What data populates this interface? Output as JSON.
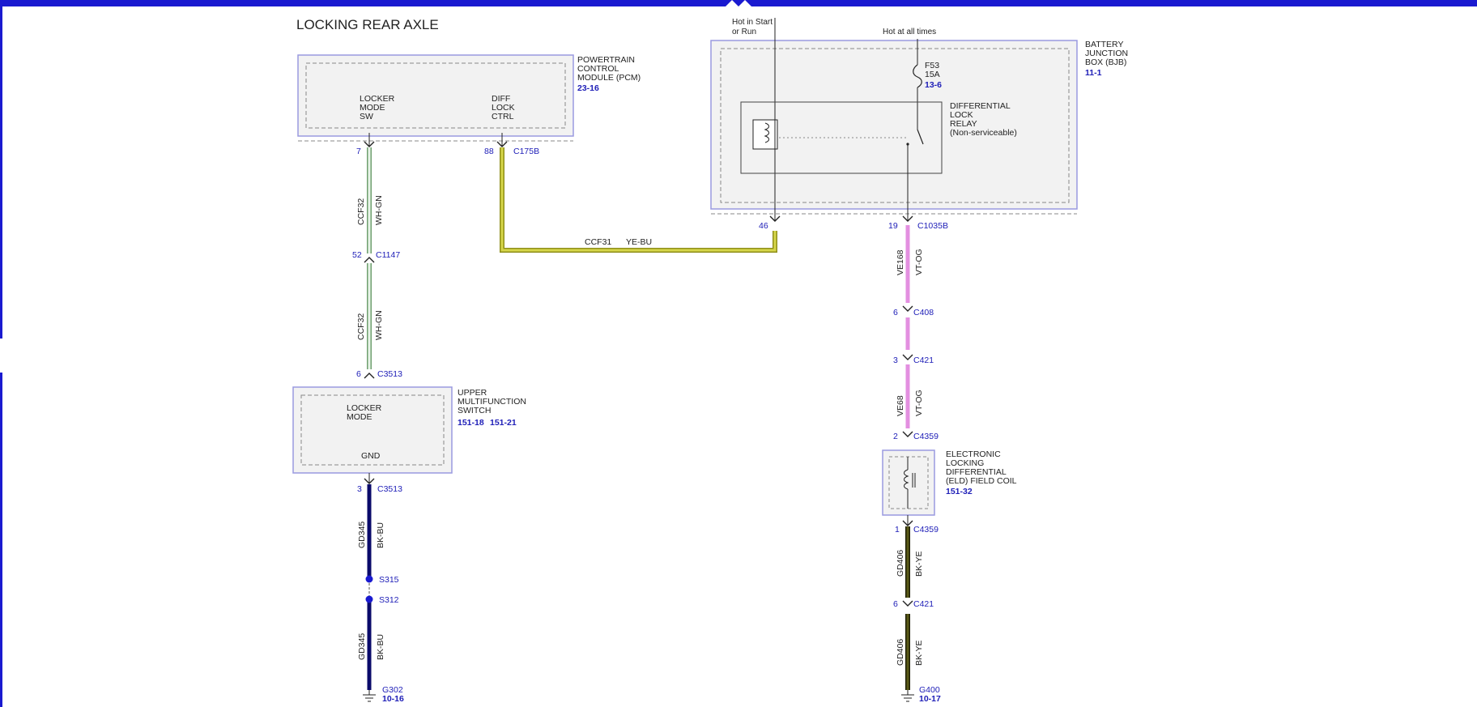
{
  "title": "LOCKING REAR AXLE",
  "colors": {
    "frame": "#1a1ad0",
    "module_border": "#9a9ae0",
    "module_fill": "#f2f2f2",
    "dashed": "#888888",
    "label": "#222222",
    "link": "#2020b8",
    "wire_wh_gn": "#9ec79e",
    "wire_ye_bu": "#c9c93a",
    "wire_bk_bu": "#0a0a6a",
    "wire_vt_og": "#e58ee0",
    "wire_bk_ye": "#4a4a14"
  },
  "power": {
    "hot_start_run": [
      "Hot in Start",
      "or Run"
    ],
    "hot_all_times": "Hot at all times"
  },
  "pcm": {
    "name": [
      "POWERTRAIN",
      "CONTROL",
      "MODULE (PCM)"
    ],
    "ref": "23-16",
    "pin_locker": [
      "LOCKER",
      "MODE",
      "SW"
    ],
    "pin_diff": [
      "DIFF",
      "LOCK",
      "CTRL"
    ],
    "pin_left_no": "7",
    "pin_right_no": "88",
    "connector": "C175B"
  },
  "bjb": {
    "name": [
      "BATTERY",
      "JUNCTION",
      "BOX (BJB)"
    ],
    "ref": "11-1",
    "fuse": [
      "F53",
      "15A"
    ],
    "fuse_ref": "13-6",
    "relay": [
      "DIFFERENTIAL",
      "LOCK",
      "RELAY",
      "(Non-serviceable)"
    ],
    "pin_left_no": "46",
    "pin_right_no": "19",
    "connector": "C1035B"
  },
  "wire_left": {
    "circuit": "CCF32",
    "color": "WH-GN",
    "conn_mid_pin": "52",
    "conn_mid": "C1147",
    "conn_bottom_pin": "6",
    "conn_bottom": "C3513"
  },
  "wire_mid": {
    "circuit": "CCF31",
    "color": "YE-BU"
  },
  "switch": {
    "name": [
      "UPPER",
      "MULTIFUNCTION",
      "SWITCH"
    ],
    "refs": [
      "151-18",
      "151-21"
    ],
    "pin_top": [
      "LOCKER",
      "MODE"
    ],
    "pin_bottom": "GND"
  },
  "ground_left": {
    "pin": "3",
    "conn": "C3513",
    "circuit": "GD345",
    "color": "BK-BU",
    "splice1": "S315",
    "splice2": "S312",
    "ground": "G302",
    "ground_ref": "10-16"
  },
  "wire_right": {
    "circuit": "VE168",
    "color": "VT-OG",
    "circuit2": "VE68",
    "c408_pin": "6",
    "c408": "C408",
    "c421_pin": "3",
    "c421": "C421",
    "c4359_pin": "2",
    "c4359": "C4359"
  },
  "eld": {
    "name": [
      "ELECTRONIC",
      "LOCKING",
      "DIFFERENTIAL",
      "(ELD) FIELD COIL"
    ],
    "ref": "151-32"
  },
  "ground_right": {
    "c4359_pin": "1",
    "c4359": "C4359",
    "circuit": "GD406",
    "color": "BK-YE",
    "c421_pin": "6",
    "c421": "C421",
    "ground": "G400",
    "ground_ref": "10-17"
  }
}
